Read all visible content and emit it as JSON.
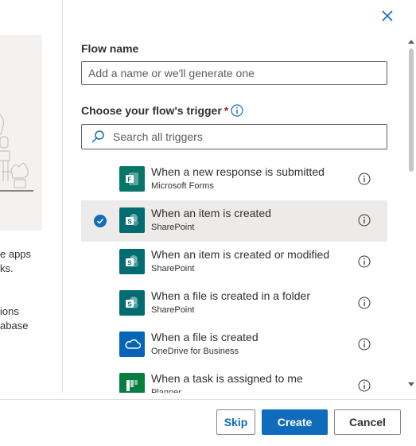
{
  "left": {
    "text1": "e apps\nks.",
    "text2": "ions\nabase"
  },
  "form": {
    "flow_name_label": "Flow name",
    "flow_name_placeholder": "Add a name or we'll generate one",
    "trigger_label": "Choose your flow's trigger",
    "required_mark": "*",
    "search_placeholder": "Search all triggers"
  },
  "triggers": [
    {
      "title": "When a new response is submitted",
      "app": "Microsoft Forms",
      "icon": "forms-icon",
      "color": "#077568",
      "selected": false
    },
    {
      "title": "When an item is created",
      "app": "SharePoint",
      "icon": "sharepoint-icon",
      "color": "#036c70",
      "selected": true
    },
    {
      "title": "When an item is created or modified",
      "app": "SharePoint",
      "icon": "sharepoint-icon",
      "color": "#036c70",
      "selected": false
    },
    {
      "title": "When a file is created in a folder",
      "app": "SharePoint",
      "icon": "sharepoint-icon",
      "color": "#036c70",
      "selected": false
    },
    {
      "title": "When a file is created",
      "app": "OneDrive for Business",
      "icon": "onedrive-icon",
      "color": "#0364b8",
      "selected": false
    },
    {
      "title": "When a task is assigned to me",
      "app": "Planner",
      "icon": "planner-icon",
      "color": "#077d3f",
      "selected": false
    }
  ],
  "footer": {
    "skip_label": "Skip",
    "create_label": "Create",
    "cancel_label": "Cancel"
  },
  "colors": {
    "accent": "#0f6cbd",
    "required": "#a4262c",
    "selected_row": "#edebe9"
  }
}
